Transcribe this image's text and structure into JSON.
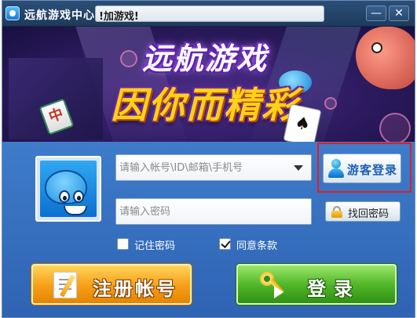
{
  "window": {
    "title": "远航游戏中心",
    "notice": "!加游戏!",
    "minimize_glyph": "—",
    "close_glyph": "✕"
  },
  "banner": {
    "headline": "远航游戏",
    "tagline": "因你而精彩",
    "mahjong_glyph": "中",
    "card_glyph": "♠"
  },
  "login": {
    "account_placeholder": "请输入帐号\\ID\\邮箱\\手机号",
    "password_placeholder": "请输入密码",
    "guest_login_label": "游客登录",
    "recover_password_label": "找回密码",
    "remember_password": {
      "label": "记住密码",
      "checked": false
    },
    "agree_terms": {
      "label": "同意条款",
      "checked": true
    },
    "register_label": "注册帐号",
    "login_label": "登录"
  },
  "colors": {
    "highlight_box": "#e02020",
    "register_button": "#f7a21c",
    "login_button": "#52b829",
    "panel": "#3e7ccb"
  },
  "icons": {
    "app": "app-logo-icon",
    "guest": "user-icon",
    "recover": "lock-icon",
    "register": "pen-paper-icon",
    "login": "key-icon"
  }
}
